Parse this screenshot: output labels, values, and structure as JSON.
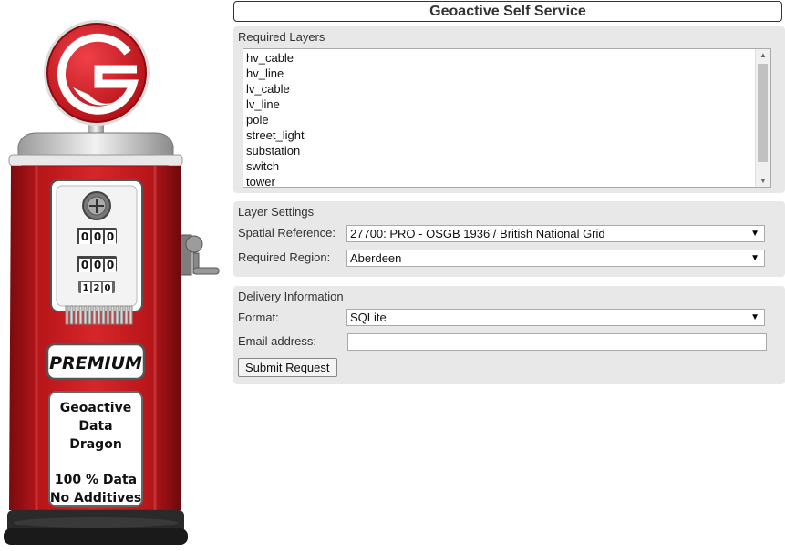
{
  "app": {
    "title": "Geoactive Self Service"
  },
  "pump": {
    "badge": "PREMIUM",
    "counter_row_1": [
      "0",
      "0",
      "0"
    ],
    "counter_row_2": [
      "0",
      "0",
      "0"
    ],
    "counter_row_3": [
      "1",
      "2",
      "0"
    ],
    "sign_lines": [
      "Geoactive",
      "Data",
      "Dragon",
      "100 % Data",
      "No Additives"
    ],
    "colors": {
      "body_red": "#c41a1e",
      "dark_red": "#8e0f12",
      "logo_red": "#d8161e"
    }
  },
  "layers": {
    "heading": "Required Layers",
    "items": [
      "hv_cable",
      "hv_line",
      "lv_cable",
      "lv_line",
      "pole",
      "street_light",
      "substation",
      "switch",
      "tower"
    ]
  },
  "settings": {
    "heading": "Layer Settings",
    "spatial_label": "Spatial Reference:",
    "spatial_value": "27700: PRO - OSGB 1936 / British National Grid",
    "region_label": "Required Region:",
    "region_value": "Aberdeen"
  },
  "delivery": {
    "heading": "Delivery Information",
    "format_label": "Format:",
    "format_value": "SQLite",
    "email_label": "Email address:",
    "email_value": "",
    "submit_label": "Submit Request"
  },
  "icons": {
    "dropdown": "chevron-down-icon",
    "scroll_up": "scroll-up-arrow-icon",
    "scroll_down": "scroll-down-arrow-icon",
    "logo": "geoactive-dragon-logo-icon",
    "gauge": "pump-gauge-icon",
    "crank": "pump-crank-handle-icon"
  }
}
